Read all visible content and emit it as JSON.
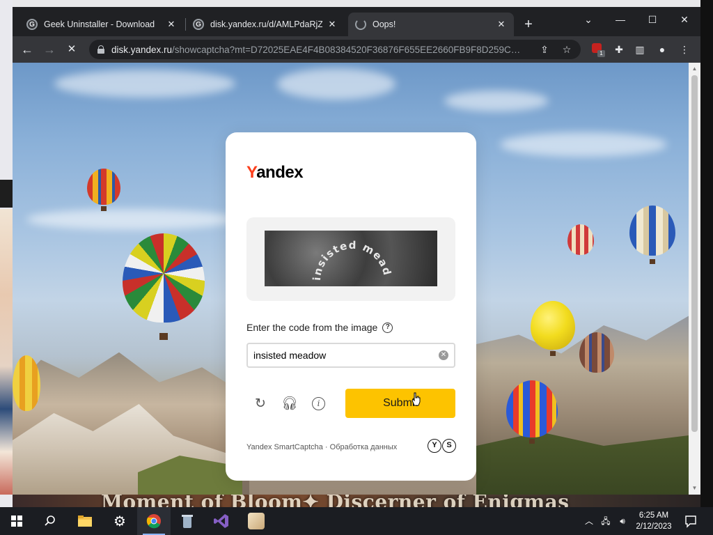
{
  "desktop": {
    "bottom_banner_text": "Moment of Bloom✦ Discerner of Enigmas"
  },
  "browser": {
    "tabs": [
      {
        "title": "Geek Uninstaller - Download",
        "active": false
      },
      {
        "title": "disk.yandex.ru/d/AMLPdaRjZuVI...",
        "active": false
      },
      {
        "title": "Oops!",
        "active": true
      }
    ],
    "new_tab_label": "+",
    "window_controls": {
      "tab_search": "⌄",
      "minimize": "—",
      "maximize": "☐",
      "close": "✕"
    },
    "address": {
      "host": "disk.yandex.ru",
      "path": "/showcaptcha?mt=D72025EAE4F4B08384520F36876F655EE2660FB9F8D259C75D..."
    },
    "extension_badge": "1"
  },
  "captcha": {
    "logo_first": "Y",
    "logo_rest": "andex",
    "captcha_image_text": "insisted meadow",
    "prompt": "Enter the code from the image",
    "help_glyph": "?",
    "input_value": "insisted meadow",
    "submit_label": "Submit",
    "footer_brand": "Yandex SmartCaptcha",
    "footer_separator": " · ",
    "footer_link": "Обработка данных",
    "brand_marks": [
      "Y",
      "S"
    ]
  },
  "taskbar": {
    "time": "6:25 AM",
    "date": "2/12/2023",
    "pinned": [
      "start-icon",
      "search-icon",
      "file-explorer-icon",
      "settings-icon",
      "chrome-icon",
      "recycle-bin-icon",
      "visual-studio-icon",
      "game-launcher-icon"
    ]
  },
  "colors": {
    "yandex_red": "#fc3f1d",
    "submit_yellow": "#fdc300",
    "chrome_dark": "#202124",
    "taskbar": "#1b1d22"
  }
}
